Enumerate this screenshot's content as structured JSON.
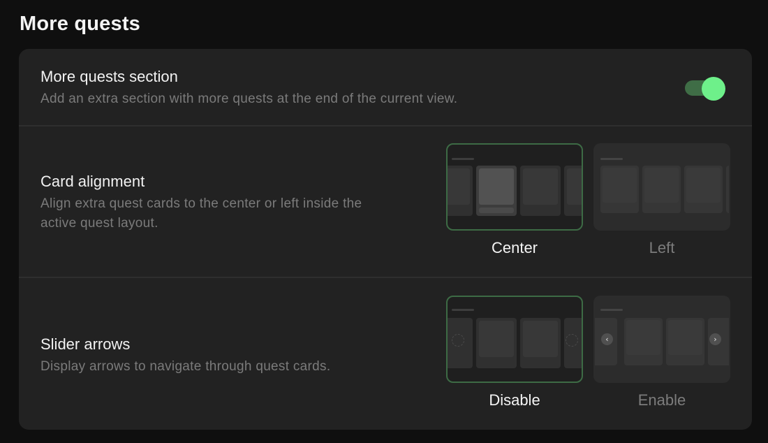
{
  "page": {
    "title": "More quests"
  },
  "more_quests_section": {
    "title": "More quests section",
    "description": "Add an extra section with more quests at the end of the current view.",
    "enabled": true
  },
  "card_alignment": {
    "title": "Card alignment",
    "description_line1": "Align extra quest cards to the center or left inside the",
    "description_line2": "active quest layout.",
    "options": [
      {
        "label": "Center",
        "selected": true
      },
      {
        "label": "Left",
        "selected": false
      }
    ]
  },
  "slider_arrows": {
    "title": "Slider arrows",
    "description": "Display arrows to navigate through quest cards.",
    "options": [
      {
        "label": "Disable",
        "selected": true
      },
      {
        "label": "Enable",
        "selected": false
      }
    ]
  },
  "icons": {
    "prev_arrow": "chevron-left-icon",
    "next_arrow": "chevron-right-icon"
  },
  "colors": {
    "accent": "#6ef08a",
    "accent_track": "#3f6d46",
    "selected_border": "#3d6b45",
    "panel_bg": "#222222",
    "page_bg": "#0f0f0f"
  }
}
